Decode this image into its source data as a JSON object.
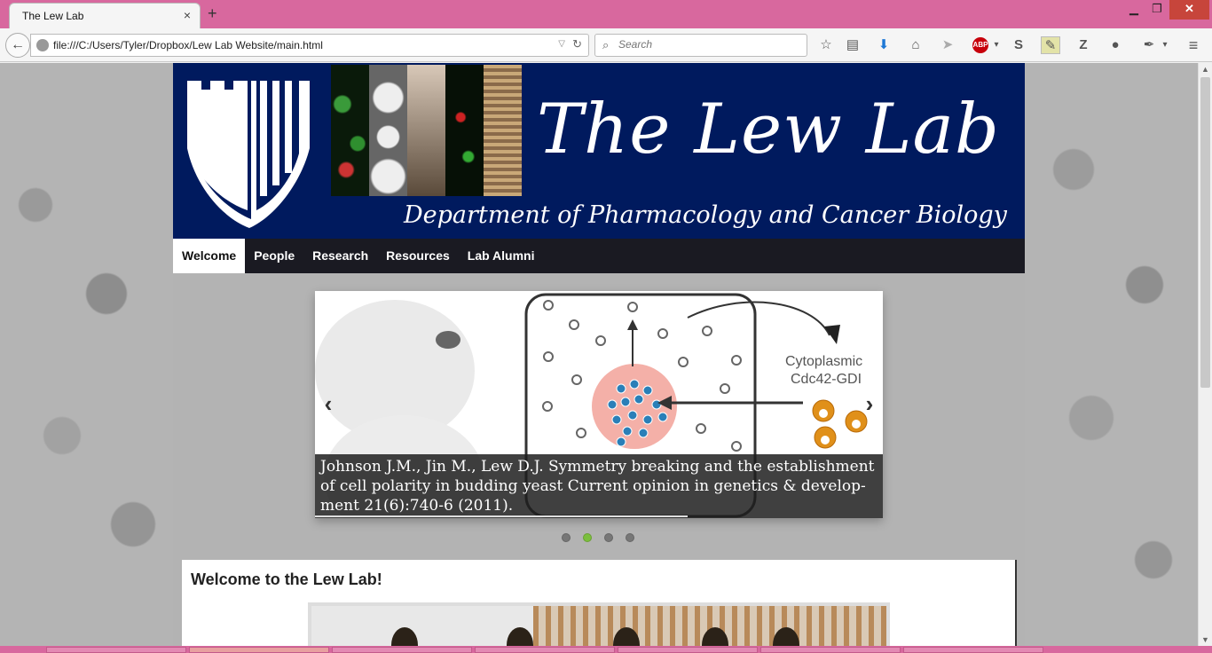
{
  "browser": {
    "tab_title": "The Lew Lab",
    "tab_close": "×",
    "new_tab": "+",
    "win_min": "▁",
    "win_max": "❐",
    "win_close": "✕",
    "url": "file:///C:/Users/Tyler/Dropbox/Lew Lab Website/main.html",
    "search_placeholder": "Search",
    "abp_label": "ABP"
  },
  "site": {
    "title": "The Lew Lab",
    "department": "Department of Pharmacology and Cancer Biology",
    "menu": [
      "Welcome",
      "People",
      "Research",
      "Resources",
      "Lab Alumni"
    ],
    "active_menu": "Welcome"
  },
  "slider": {
    "caption": "Johnson J.M., Jin M., Lew D.J. Symmetry breaking and the establishment of cell polarity in budding yeast Current opinion in genetics & develop-ment 21(6):740-6 (2011).",
    "figure_label_1": "Cytoplasmic",
    "figure_label_2": "Cdc42-GDI",
    "prev": "‹",
    "next": "›",
    "dots": 4,
    "active_dot": 2
  },
  "welcome": {
    "heading": "Welcome to the Lew Lab!"
  },
  "colors": {
    "banner": "#001a5e",
    "menu": "#1a1a22",
    "titlebar": "#d8689e",
    "active_dot": "#7bbf3e"
  }
}
